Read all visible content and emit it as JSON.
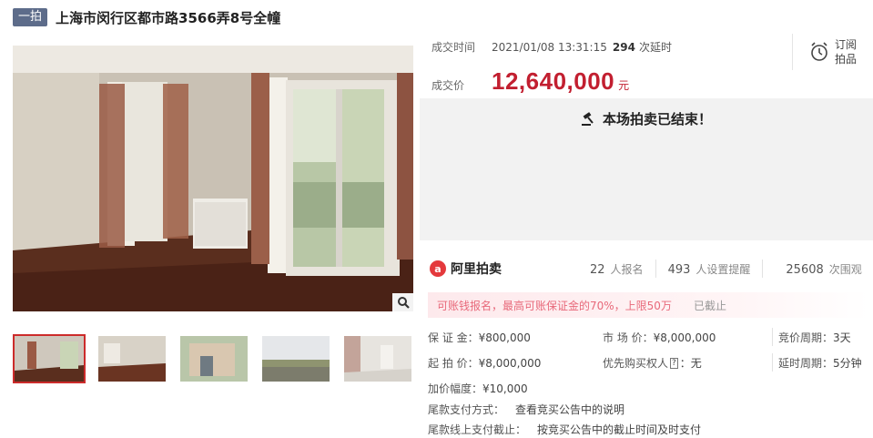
{
  "header": {
    "tag": "一拍",
    "title": "上海市闵行区都市路3566弄8号全幢"
  },
  "deal": {
    "time_label": "成交时间",
    "time_value": "2021/01/08 13:31:15",
    "delay_count": "294",
    "delay_unit": "次延时",
    "price_label": "成交价",
    "price_value": "12,640,000",
    "price_unit": "元"
  },
  "subscribe": {
    "line1": "订阅",
    "line2": "拍品"
  },
  "status": {
    "ended_text": "本场拍卖已结束！"
  },
  "brand": {
    "logo_char": "a",
    "name": "阿里拍卖"
  },
  "stats": [
    {
      "value": "22",
      "unit": "人报名"
    },
    {
      "value": "493",
      "unit": "人设置提醒"
    },
    {
      "value": "25608",
      "unit": "次围观"
    }
  ],
  "notice": {
    "text": "可账钱报名，最高可账保证金的70%，上限50万",
    "closed": "已截止"
  },
  "terms": {
    "deposit_label": "保 证 金：",
    "deposit_value": "¥800,000",
    "market_label": "市 场 价：",
    "market_value": "¥8,000,000",
    "cycle_label": "竞价周期：",
    "cycle_value": "3天",
    "start_label": "起 拍 价：",
    "start_value": "¥8,000,000",
    "priority_label": "优先购买权人",
    "priority_badge": "?",
    "priority_value": "：无",
    "extend_label": "延时周期：",
    "extend_value": "5分钟",
    "increment_label": "加价幅度：",
    "increment_value": "¥10,000"
  },
  "payment": {
    "method_label": "尾款支付方式：",
    "method_value": "查看竞买公告中的说明",
    "deadline_label": "尾款线上支付截止：",
    "deadline_value": "按竞买公告中的截止时间及时支付"
  },
  "colors": {
    "accent_red": "#c21f30",
    "tag_bg": "#5d6c8a",
    "notice_text": "#e8697a"
  }
}
